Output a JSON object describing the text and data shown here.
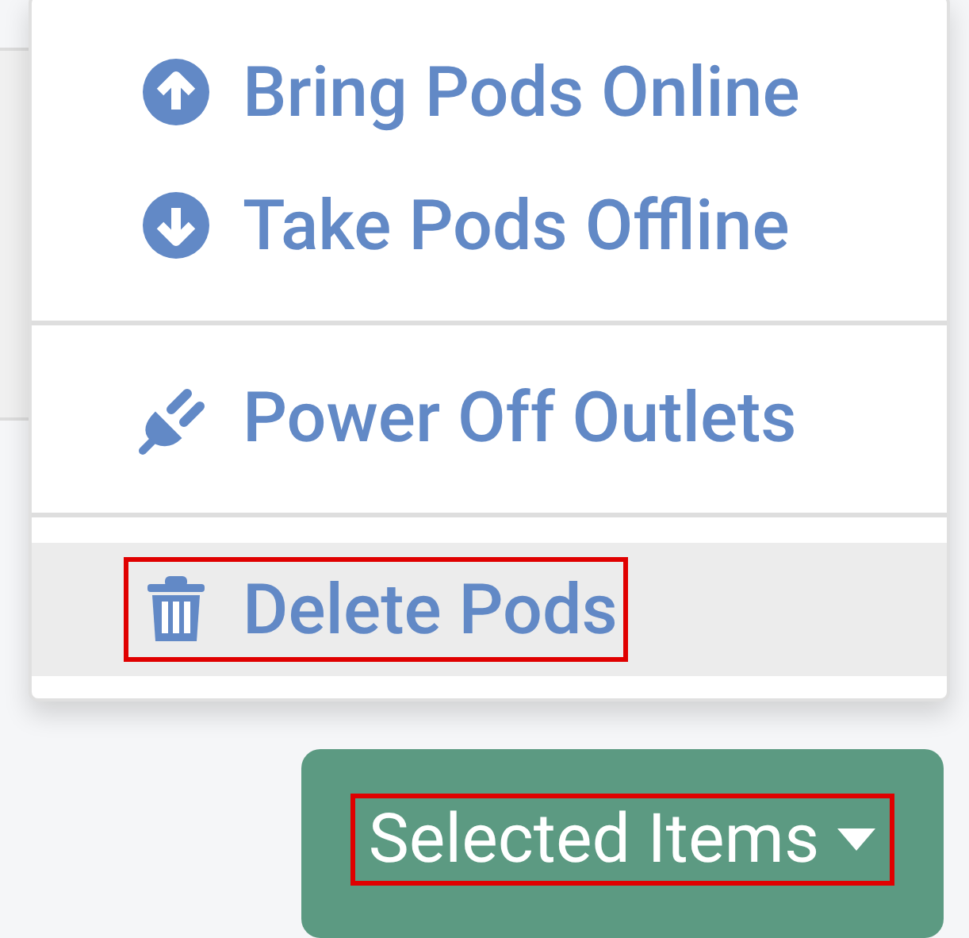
{
  "menu": {
    "sections": [
      {
        "items": [
          {
            "kind": "up",
            "label": "Bring Pods Online",
            "hovered": false,
            "highlighted": false
          },
          {
            "kind": "down",
            "label": "Take Pods Offline",
            "hovered": false,
            "highlighted": false
          }
        ]
      },
      {
        "items": [
          {
            "kind": "plug",
            "label": "Power Off Outlets",
            "hovered": false,
            "highlighted": false
          }
        ]
      },
      {
        "items": [
          {
            "kind": "trash",
            "label": "Delete Pods",
            "hovered": true,
            "highlighted": true
          }
        ]
      }
    ]
  },
  "button": {
    "label": "Selected Items",
    "highlighted": true
  }
}
